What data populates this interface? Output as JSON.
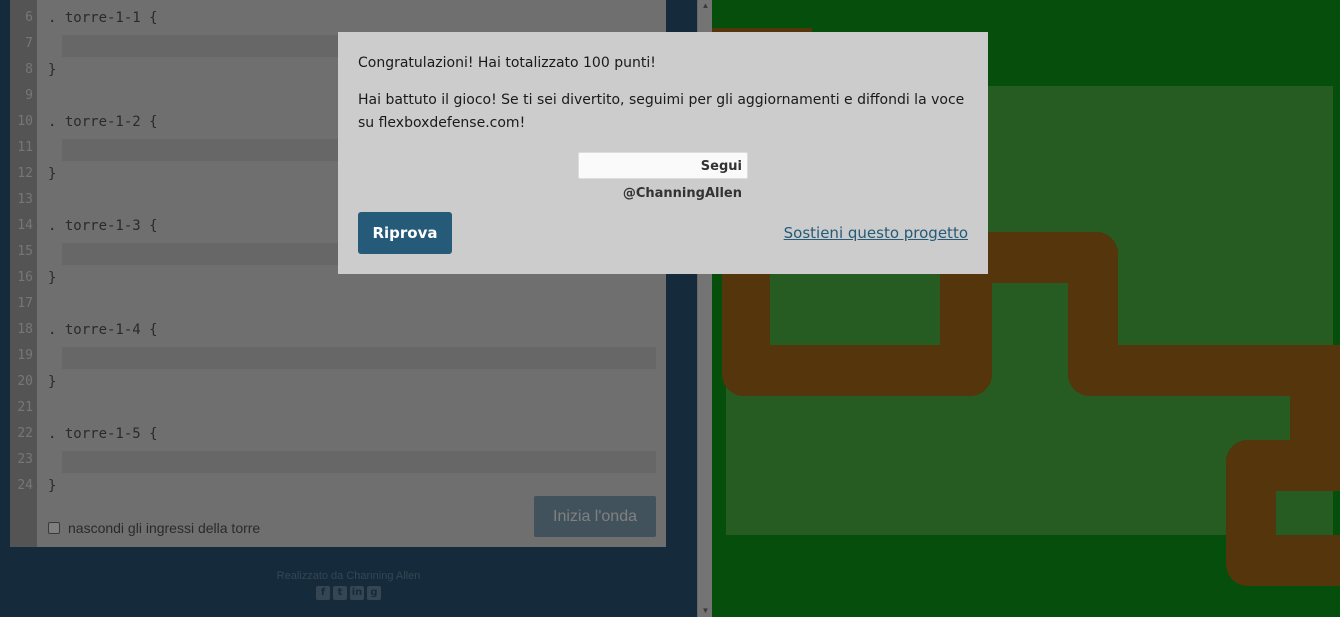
{
  "editor": {
    "lines": [
      {
        "num": "6",
        "text": ". torre-1-1 {"
      },
      {
        "num": "7",
        "text": ""
      },
      {
        "num": "8",
        "text": "}"
      },
      {
        "num": "9",
        "text": ""
      },
      {
        "num": "10",
        "text": ". torre-1-2 {"
      },
      {
        "num": "11",
        "text": ""
      },
      {
        "num": "12",
        "text": "}"
      },
      {
        "num": "13",
        "text": ""
      },
      {
        "num": "14",
        "text": ". torre-1-3 {"
      },
      {
        "num": "15",
        "text": ""
      },
      {
        "num": "16",
        "text": "}"
      },
      {
        "num": "17",
        "text": ""
      },
      {
        "num": "18",
        "text": ". torre-1-4 {"
      },
      {
        "num": "19",
        "text": ""
      },
      {
        "num": "20",
        "text": "}"
      },
      {
        "num": "21",
        "text": ""
      },
      {
        "num": "22",
        "text": ". torre-1-5 {"
      },
      {
        "num": "23",
        "text": ""
      },
      {
        "num": "24",
        "text": "}"
      }
    ],
    "start_wave_label": "Inizia l'onda",
    "hide_tower_inputs_label": "nascondi gli ingressi della torre"
  },
  "footer": {
    "credit": "Realizzato da Channing Allen",
    "social_icons": [
      "facebook-icon",
      "twitter-icon",
      "linkedin-icon",
      "github-icon"
    ]
  },
  "modal": {
    "title": "Congratulazioni! Hai totalizzato 100 punti!",
    "body": "Hai battuto il gioco! Se ti sei divertito, seguimi per gli aggiornamenti e diffondi la voce su flexboxdefense.com!",
    "follow_label": "Segui @ChanningAllen",
    "retry_label": "Riprova",
    "support_label": "Sostieni questo progetto"
  },
  "colors": {
    "board_green": "#0a9d17",
    "path_brown": "#a86a19",
    "accent_blue": "#255a78"
  }
}
